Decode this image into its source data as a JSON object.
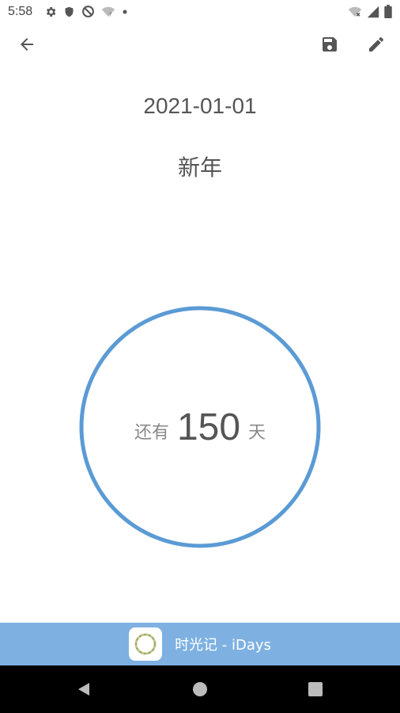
{
  "status_bar": {
    "time": "5:58",
    "icons_left": [
      "settings-icon",
      "shield-icon",
      "no-sync-icon",
      "wifi-question-icon",
      "dot-icon"
    ],
    "icons_right": [
      "wifi-off-icon",
      "signal-icon",
      "battery-icon"
    ]
  },
  "toolbar": {
    "back_icon": "arrow-back-icon",
    "save_icon": "save-icon",
    "edit_icon": "edit-pencil-icon"
  },
  "event": {
    "date": "2021-01-01",
    "title": "新年"
  },
  "countdown": {
    "prefix": "还有",
    "days": "150",
    "suffix": "天",
    "ring_color": "#5b9bd5"
  },
  "banner": {
    "app_name": "时光记 - iDays",
    "background_color": "#7eb1e2"
  },
  "nav_bar": {
    "back_icon": "nav-back-triangle-icon",
    "home_icon": "nav-home-circle-icon",
    "recents_icon": "nav-recents-square-icon"
  }
}
